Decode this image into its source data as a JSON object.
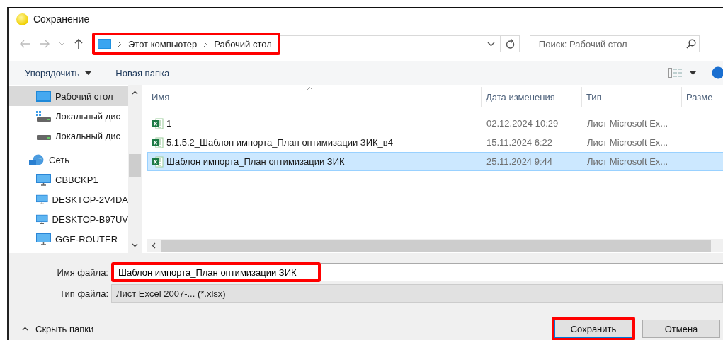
{
  "window": {
    "title": "Сохранение"
  },
  "address_bar": {
    "highlighted": true,
    "segments": [
      "Этот компьютер",
      "Рабочий стол"
    ]
  },
  "search": {
    "placeholder": "Поиск: Рабочий стол"
  },
  "toolbar": {
    "buttons": [
      "Упорядочить",
      "Новая папка"
    ]
  },
  "sidebar": {
    "items": [
      {
        "label": "Рабочий стол",
        "kind": "desktop",
        "selected": true
      },
      {
        "label": "Локальный дис",
        "kind": "system-drive",
        "selected": false
      },
      {
        "label": "Локальный дис",
        "kind": "drive",
        "selected": false
      },
      {
        "label": "Сеть",
        "kind": "network",
        "selected": false,
        "children": [
          {
            "label": "CBBCKP1",
            "kind": "computer",
            "selected": false
          },
          {
            "label": "DESKTOP-2V4DA",
            "kind": "computer",
            "selected": false
          },
          {
            "label": "DESKTOP-B97UV",
            "kind": "computer",
            "selected": false
          },
          {
            "label": "GGE-ROUTER",
            "kind": "computer",
            "selected": false
          }
        ]
      }
    ]
  },
  "table": {
    "columns": [
      "Имя",
      "Дата изменения",
      "Тип",
      "Разме"
    ],
    "rows": [
      {
        "name": "1",
        "date": "02.12.2024 10:29",
        "type": "Лист Microsoft Ex...",
        "selected": false
      },
      {
        "name": "5.1.5.2_Шаблон импорта_План оптимизации ЗИК_в4",
        "date": "15.11.2024 6:22",
        "type": "Лист Microsoft Ex...",
        "selected": false
      },
      {
        "name": "Шаблон импорта_План оптимизации ЗИК",
        "date": "25.11.2024 9:44",
        "type": "Лист Microsoft Ex...",
        "selected": true
      }
    ]
  },
  "file_name": {
    "label": "Имя файла:",
    "value": "Шаблон импорта_План оптимизации ЗИК",
    "highlighted": true
  },
  "file_type": {
    "label": "Тип файла:",
    "value": "Лист Excel 2007-... (*.xlsx)"
  },
  "hide_folders": "Скрыть папки",
  "buttons": [
    {
      "label": "Сохранить",
      "highlighted": true
    },
    {
      "label": "Отмена",
      "highlighted": false
    }
  ]
}
